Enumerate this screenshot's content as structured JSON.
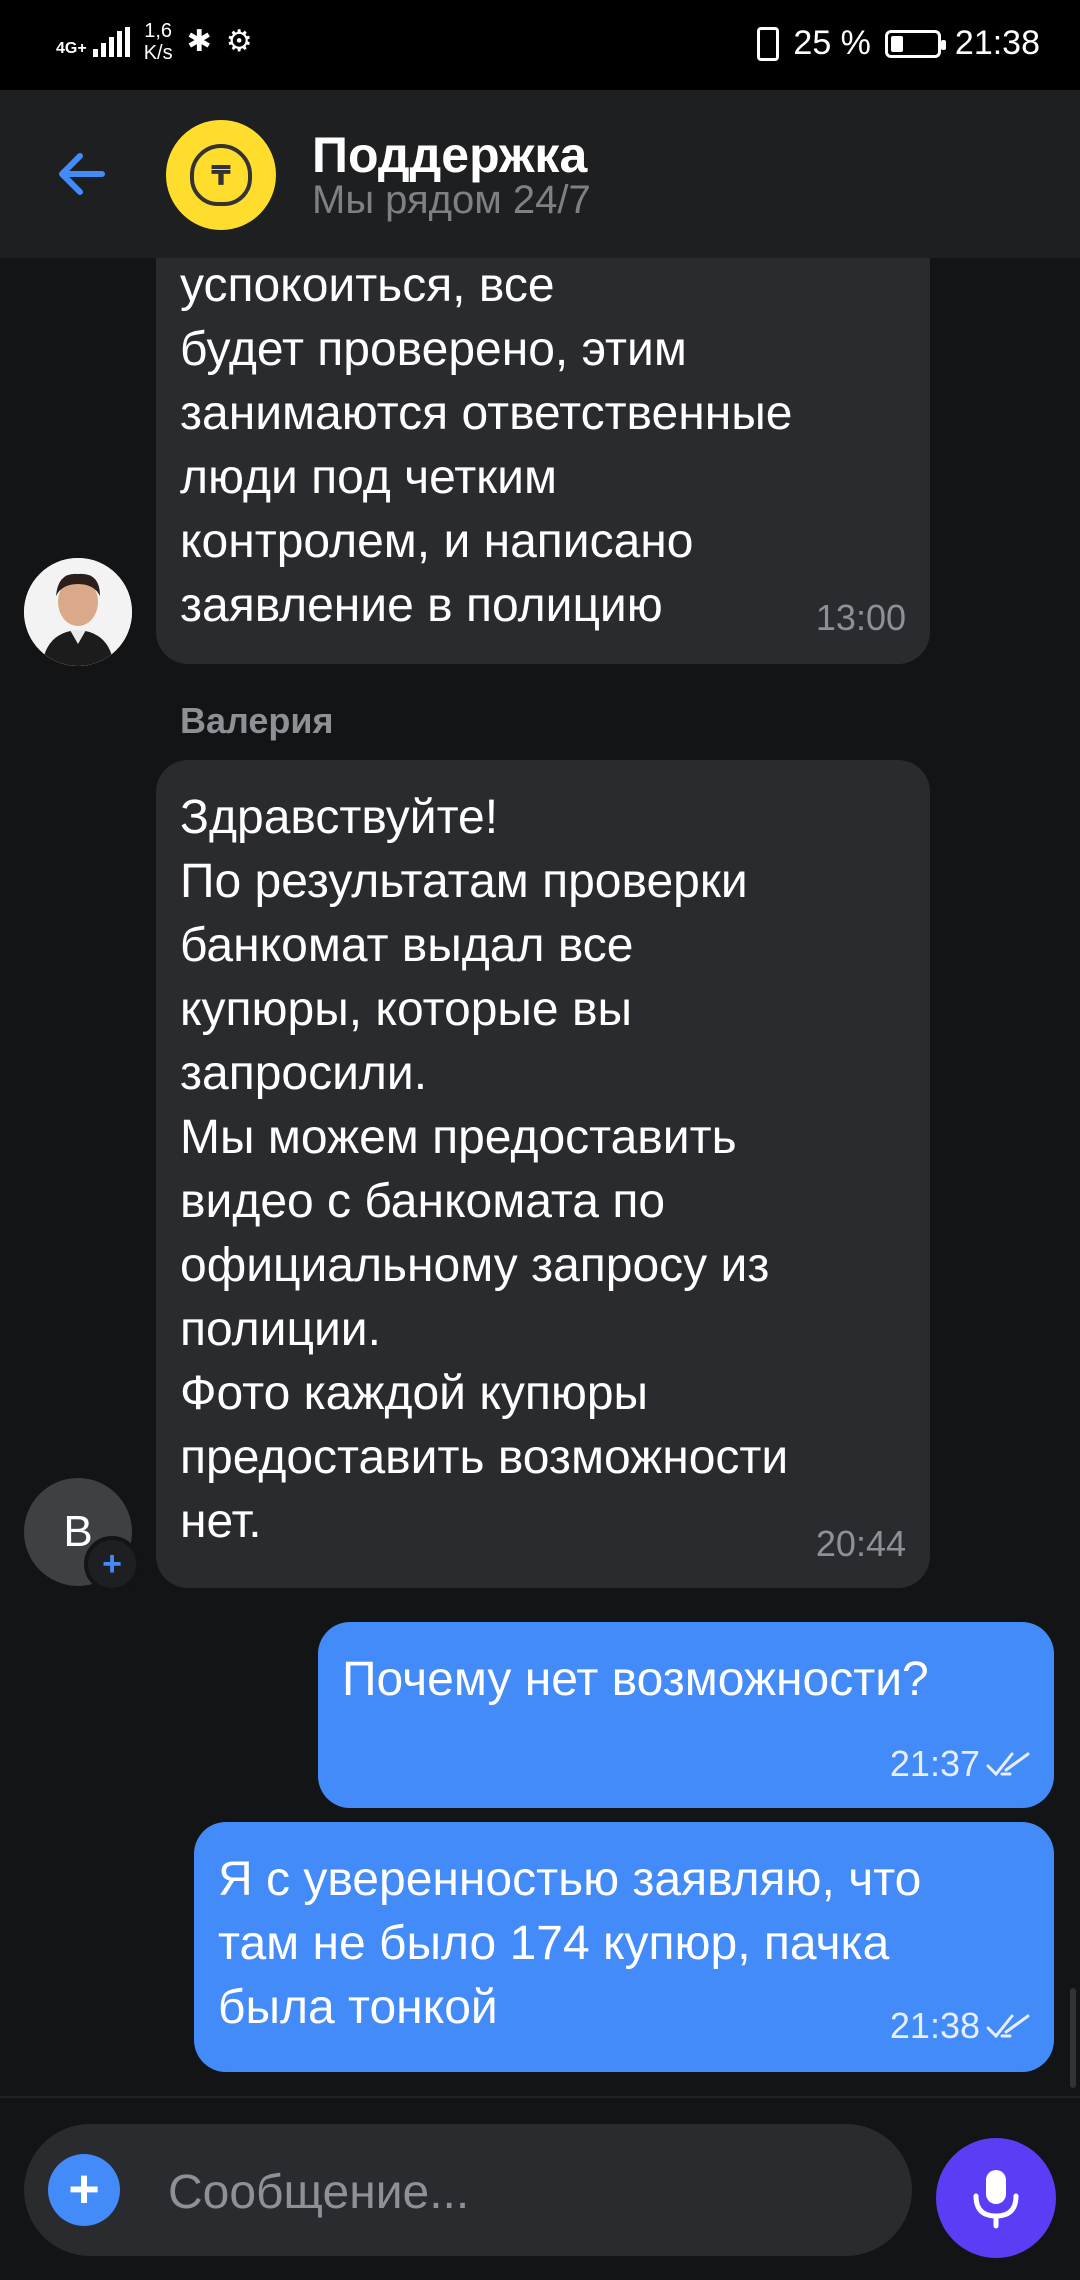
{
  "status_bar": {
    "network": "4G+",
    "speed_value": "1,6",
    "speed_unit": "K/s",
    "battery_percent": "25 %",
    "battery_level": 0.25,
    "time": "21:38",
    "icons": [
      "signal-icon",
      "bluetooth-icon",
      "nfc-icon",
      "vibrate-icon",
      "battery-icon"
    ]
  },
  "header": {
    "title": "Поддержка",
    "subtitle": "Мы рядом 24/7",
    "back_icon": "arrow-left-icon",
    "logo": "bank-logo"
  },
  "messages": [
    {
      "direction": "in",
      "text": "успокоиться, все\nбудет проверено, этим\nзанимаются ответственные\nлюди под четким\nконтролем, и написано\nзаявление в полицию",
      "time": "13:00"
    },
    {
      "direction": "in",
      "sender": "Валерия",
      "avatar_letter": "В",
      "text": "Здравствуйте!\nПо результатам проверки\nбанкомат выдал все\nкупюры, которые вы\nзапросили.\nМы можем предоставить\nвидео с банкомата по\nофициальному запросу из\nполиции.\nФото каждой купюры\nпредоставить возможности\nнет.",
      "time": "20:44"
    },
    {
      "direction": "out",
      "text": "Почему нет возможности?",
      "time": "21:37",
      "status": "read"
    },
    {
      "direction": "out",
      "text": "Я с уверенностью заявляю, что\nтам не было 174 купюр, пачка\nбыла тонкой",
      "time": "21:38",
      "status": "read"
    }
  ],
  "composer": {
    "placeholder": "Сообщение...",
    "add_icon": "plus-icon",
    "mic_icon": "microphone-icon"
  },
  "colors": {
    "accent": "#428bf9",
    "mic": "#5a3df5",
    "logo_yellow": "#ffdd2d",
    "incoming_bubble": "#2a2b2e",
    "chat_bg": "#131416"
  }
}
